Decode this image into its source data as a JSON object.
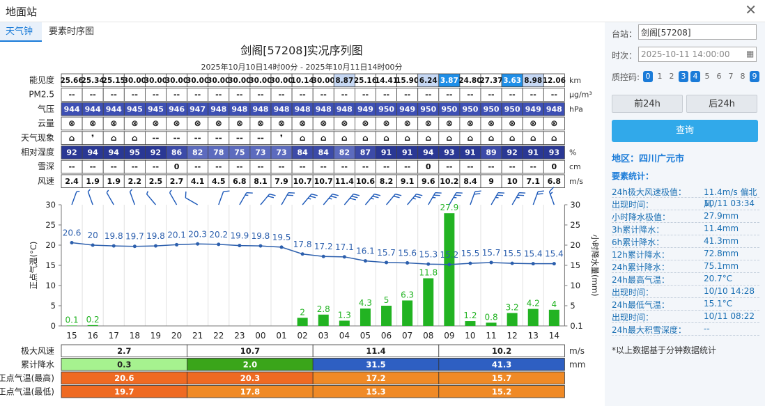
{
  "window": {
    "title": "地面站"
  },
  "tabs": [
    {
      "label": "天气钟"
    },
    {
      "label": "要素时序图"
    }
  ],
  "header": {
    "title": "剑阁[57208]实况序列图",
    "subtitle": "2025年10月10日14时00分 - 2025年10月11日14时00分"
  },
  "rows": [
    {
      "label": "能见度",
      "unit": "km",
      "kind": "vis",
      "values": [
        "25.66",
        "25.34",
        "25.15",
        "30.00",
        "30.00",
        "30.00",
        "30.00",
        "30.00",
        "30.00",
        "30.00",
        "30.00",
        "10.14",
        "30.00",
        "8.87",
        "25.16",
        "14.41",
        "15.90",
        "6.24",
        "3.87",
        "24.80",
        "27.37",
        "3.63",
        "8.98",
        "12.06"
      ]
    },
    {
      "label": "PM2.5",
      "unit": "μg/m³",
      "kind": "plain",
      "values": [
        "--",
        "--",
        "--",
        "--",
        "--",
        "--",
        "--",
        "--",
        "--",
        "--",
        "--",
        "--",
        "--",
        "--",
        "--",
        "--",
        "--",
        "--",
        "--",
        "--",
        "--",
        "--",
        "--",
        "--"
      ]
    },
    {
      "label": "气压",
      "unit": "hPa",
      "kind": "pres",
      "values": [
        "944",
        "944",
        "944",
        "945",
        "945",
        "946",
        "947",
        "948",
        "948",
        "948",
        "948",
        "948",
        "948",
        "948",
        "949",
        "950",
        "949",
        "950",
        "950",
        "950",
        "950",
        "950",
        "949",
        "948"
      ]
    },
    {
      "label": "云量",
      "unit": "",
      "kind": "cloud",
      "values": [
        "⊗",
        "⊗",
        "⊗",
        "⊗",
        "⊗",
        "⊗",
        "⊗",
        "⊗",
        "⊗",
        "⊗",
        "⊗",
        "⊗",
        "⊗",
        "⊗",
        "⊗",
        "⊗",
        "⊗",
        "⊗",
        "⊗",
        "⊗",
        "⊗",
        "⊗",
        "⊗",
        "⊗"
      ]
    },
    {
      "label": "天气现象",
      "unit": "",
      "kind": "wx",
      "values": [
        "⌂",
        "❜",
        "⌂",
        "⌂",
        "--",
        "--",
        "--",
        "--",
        "--",
        "--",
        "❜",
        "⌂",
        "⌂",
        "⌂",
        "⌂",
        "⌂",
        "⌂",
        "⌂",
        "⌂",
        "⌂",
        "⌂",
        "⌂",
        "⌂",
        "⌂"
      ]
    },
    {
      "label": "相对湿度",
      "unit": "%",
      "kind": "rh",
      "values": [
        "92",
        "94",
        "94",
        "95",
        "92",
        "86",
        "82",
        "78",
        "75",
        "73",
        "73",
        "84",
        "84",
        "82",
        "87",
        "91",
        "91",
        "94",
        "93",
        "91",
        "89",
        "92",
        "91",
        "93"
      ]
    },
    {
      "label": "雪深",
      "unit": "cm",
      "kind": "plain",
      "values": [
        "--",
        "--",
        "--",
        "--",
        "--",
        "0",
        "--",
        "--",
        "--",
        "--",
        "--",
        "--",
        "--",
        "--",
        "--",
        "--",
        "--",
        "0",
        "--",
        "--",
        "--",
        "--",
        "--",
        "0"
      ]
    },
    {
      "label": "风速",
      "unit": "m/s",
      "kind": "plain",
      "values": [
        "2.4",
        "1.9",
        "1.9",
        "2.2",
        "2.5",
        "2.7",
        "4.1",
        "4.5",
        "6.8",
        "8.1",
        "7.9",
        "10.7",
        "10.7",
        "11.4",
        "10.6",
        "8.2",
        "9.1",
        "9.6",
        "10.2",
        "8.4",
        "9",
        "10",
        "7.1",
        "6.8"
      ]
    }
  ],
  "chart_data": {
    "type": "line",
    "x": [
      "15",
      "16",
      "17",
      "18",
      "19",
      "20",
      "21",
      "22",
      "23",
      "00",
      "01",
      "02",
      "03",
      "04",
      "05",
      "06",
      "07",
      "08",
      "09",
      "10",
      "11",
      "12",
      "13",
      "14"
    ],
    "series": [
      {
        "axis": "left",
        "type": "line",
        "color": "#2c5fad",
        "values": [
          20.6,
          20,
          19.8,
          19.7,
          19.8,
          20.1,
          20.3,
          20.2,
          19.9,
          19.8,
          19.5,
          17.8,
          17.2,
          17.1,
          16.1,
          15.7,
          15.6,
          15.3,
          15.2,
          15.5,
          15.7,
          15.5,
          15.4,
          15.4
        ]
      },
      {
        "axis": "right",
        "type": "bar",
        "color": "#22b322",
        "values": [
          0.1,
          0.2,
          null,
          null,
          null,
          null,
          null,
          null,
          null,
          null,
          null,
          2,
          2.8,
          1.3,
          4.3,
          5,
          6.3,
          11.8,
          27.9,
          1.2,
          0.8,
          3.2,
          4.2,
          4
        ]
      }
    ],
    "ylabel": "正点气温(°C)",
    "y2label": "小时降水量(mm)",
    "yticks": [
      "0",
      "5",
      "10",
      "15",
      "20",
      "25",
      "30"
    ],
    "y2ticks": [
      "0.1",
      "5",
      "10",
      "15",
      "20",
      "25",
      "30"
    ],
    "ylim": [
      0,
      30
    ],
    "y2lim": [
      0,
      30
    ],
    "grid": "vertical",
    "wind_barbs": "top"
  },
  "summary_rows": [
    {
      "label": "极大风速",
      "unit": "m/s",
      "segments": [
        {
          "value": "2.7",
          "bg": "#ffffff",
          "fg": "#222222"
        },
        {
          "value": "10.7",
          "bg": "#ffffff",
          "fg": "#222222"
        },
        {
          "value": "11.4",
          "bg": "#ffffff",
          "fg": "#222222"
        },
        {
          "value": "10.2",
          "bg": "#ffffff",
          "fg": "#222222"
        }
      ]
    },
    {
      "label": "累计降水",
      "unit": "mm",
      "segments": [
        {
          "value": "0.3",
          "bg": "#a6f28f",
          "fg": "#222222"
        },
        {
          "value": "2.0",
          "bg": "#3aa51a",
          "fg": "#ffffff"
        },
        {
          "value": "31.5",
          "bg": "#2e5fc2",
          "fg": "#ffffff"
        },
        {
          "value": "41.3",
          "bg": "#2e5fc2",
          "fg": "#ffffff"
        }
      ]
    },
    {
      "label": "正点气温(最高)",
      "unit": "",
      "segments": [
        {
          "value": "20.6",
          "bg": "#ef6a22",
          "fg": "#ffffff"
        },
        {
          "value": "20.3",
          "bg": "#ef6a22",
          "fg": "#ffffff"
        },
        {
          "value": "17.2",
          "bg": "#f08a26",
          "fg": "#ffffff"
        },
        {
          "value": "15.7",
          "bg": "#f08a26",
          "fg": "#ffffff"
        }
      ]
    },
    {
      "label": "正点气温(最低)",
      "unit": "",
      "segments": [
        {
          "value": "19.7",
          "bg": "#ef6a22",
          "fg": "#ffffff"
        },
        {
          "value": "17.8",
          "bg": "#f08a26",
          "fg": "#ffffff"
        },
        {
          "value": "15.3",
          "bg": "#f08a26",
          "fg": "#ffffff"
        },
        {
          "value": "15.2",
          "bg": "#f08a26",
          "fg": "#ffffff"
        }
      ]
    }
  ],
  "sidebar": {
    "station_label": "台站：",
    "station_value": "剑阁[57208]",
    "time_label": "时次：",
    "time_value": "2025-10-11 14:00:00",
    "qc_label": "质控码:",
    "qc_codes": [
      {
        "code": "0",
        "on": true
      },
      {
        "code": "1",
        "on": false
      },
      {
        "code": "2",
        "on": false
      },
      {
        "code": "3",
        "on": true
      },
      {
        "code": "4",
        "on": true
      },
      {
        "code": "5",
        "on": false
      },
      {
        "code": "6",
        "on": false
      },
      {
        "code": "7",
        "on": false
      },
      {
        "code": "8",
        "on": false
      },
      {
        "code": "9",
        "on": true
      }
    ],
    "prev_label": "前24h",
    "next_label": "后24h",
    "query_label": "查询",
    "region": "地区：四川广元市",
    "stats_title": "要素统计：",
    "stats": [
      {
        "k": "24h极大风速极值：",
        "v": "11.4m/s 偏北风"
      },
      {
        "k": "出现时间：",
        "v": "10/11 03:34"
      },
      {
        "k": "小时降水极值：",
        "v": "27.9mm"
      },
      {
        "k": "3h累计降水：",
        "v": "11.4mm"
      },
      {
        "k": "6h累计降水：",
        "v": "41.3mm"
      },
      {
        "k": "12h累计降水：",
        "v": "72.8mm"
      },
      {
        "k": "24h累计降水：",
        "v": "75.1mm"
      },
      {
        "k": "24h最高气温：",
        "v": "20.7°C"
      },
      {
        "k": "出现时间：",
        "v": "10/10 14:28"
      },
      {
        "k": "24h最低气温：",
        "v": "15.1°C"
      },
      {
        "k": "出现时间：",
        "v": "10/11 08:22"
      },
      {
        "k": "24h最大积雪深度：",
        "v": "--"
      }
    ],
    "note": "*以上数据基于分钟数据统计"
  }
}
